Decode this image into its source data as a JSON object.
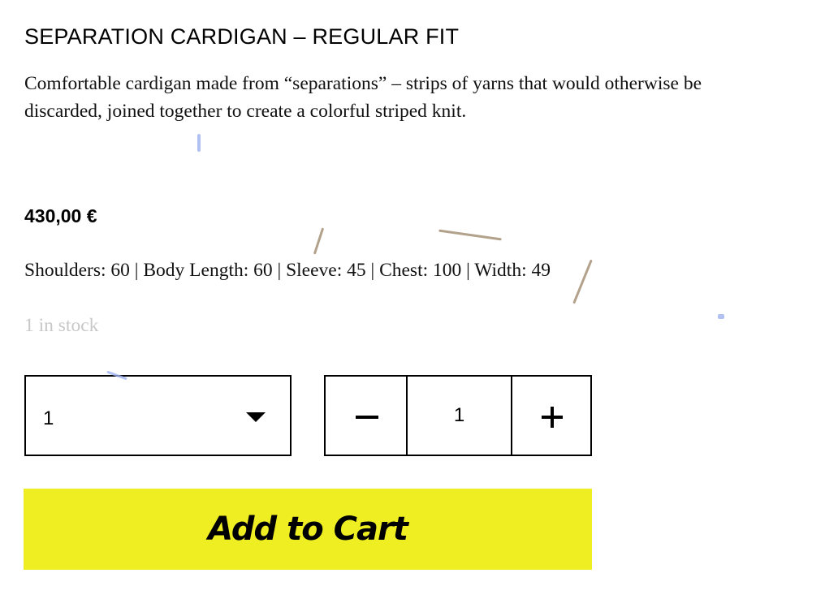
{
  "product": {
    "title": "SEPARATION CARDIGAN – REGULAR FIT",
    "description": "Comfortable cardigan made from “separations” – strips of yarns that would otherwise be discarded, joined together to create a colorful striped knit.",
    "price": "430,00 €",
    "measurements": "Shoulders: 60 | Body Length: 60 | Sleeve: 45 | Chest: 100 | Width: 49",
    "stock": "1 in stock"
  },
  "variant_select": {
    "value": "1",
    "icon": "triangle-down-icon"
  },
  "quantity": {
    "value": "1",
    "decrease_icon": "minus-icon",
    "increase_icon": "plus-icon"
  },
  "cart": {
    "button_label": "Add to Cart",
    "button_color": "#eeee22"
  }
}
